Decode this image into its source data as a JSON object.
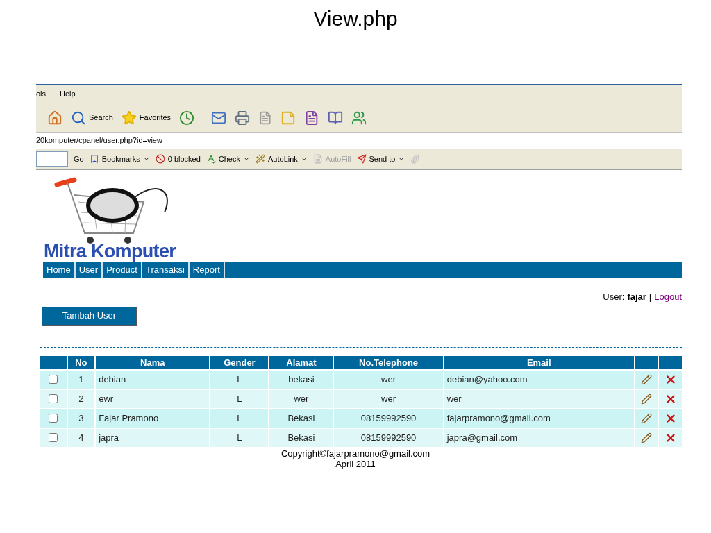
{
  "slide_title": "View.php",
  "browser": {
    "menu": [
      "ols",
      "Help"
    ],
    "toolbar": [
      {
        "label": "Search"
      },
      {
        "label": "Favorites"
      }
    ],
    "address": "20komputer/cpanel/user.php?id=view",
    "addon_toolbar": [
      {
        "label": "Go",
        "dropdown": false,
        "disabled": false
      },
      {
        "label": "Bookmarks",
        "dropdown": true,
        "disabled": false
      },
      {
        "label": "0 blocked",
        "dropdown": false,
        "disabled": false
      },
      {
        "label": "Check",
        "dropdown": true,
        "disabled": false
      },
      {
        "label": "AutoLink",
        "dropdown": true,
        "disabled": false
      },
      {
        "label": "AutoFill",
        "dropdown": false,
        "disabled": true
      },
      {
        "label": "Send to",
        "dropdown": true,
        "disabled": false
      }
    ]
  },
  "site": {
    "logo_text": "Mitra Komputer",
    "nav": [
      {
        "label": "Home"
      },
      {
        "label": "User"
      },
      {
        "label": "Product"
      },
      {
        "label": "Transaksi"
      },
      {
        "label": "Report"
      }
    ],
    "user_label": "User:",
    "user_name": "fajar",
    "separator": "|",
    "logout": "Logout",
    "add_button": "Tambah User",
    "table": {
      "columns": [
        "No",
        "Nama",
        "Gender",
        "Alamat",
        "No.Telephone",
        "Email"
      ],
      "rows": [
        {
          "checked": false,
          "cells": [
            "1",
            "debian",
            "L",
            "bekasi",
            "wer",
            "debian@yahoo.com"
          ]
        },
        {
          "checked": false,
          "cells": [
            "2",
            "ewr",
            "L",
            "wer",
            "wer",
            "wer"
          ]
        },
        {
          "checked": false,
          "cells": [
            "3",
            "Fajar Pramono",
            "L",
            "Bekasi",
            "08159992590",
            "fajarpramono@gmail.com"
          ]
        },
        {
          "checked": false,
          "cells": [
            "4",
            "japra",
            "L",
            "Bekasi",
            "08159992590",
            "japra@gmail.com"
          ]
        }
      ]
    },
    "footer": [
      "Copyright©fajarpramono@gmail.com",
      "April 2011"
    ]
  }
}
